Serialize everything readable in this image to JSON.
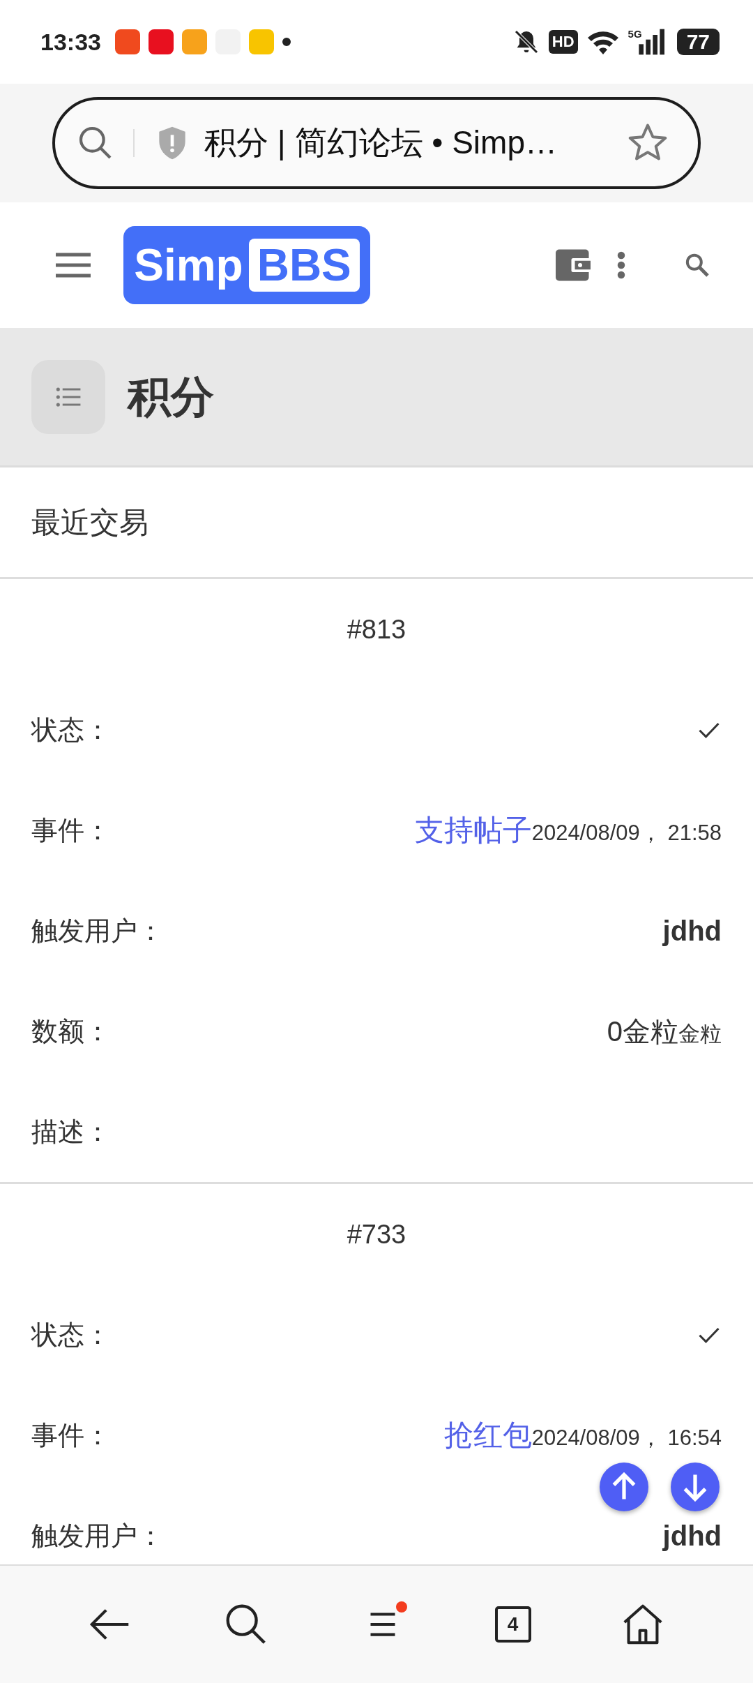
{
  "status_bar": {
    "time": "13:33",
    "notifications": [
      {
        "color": "#f04a1e"
      },
      {
        "color": "#e8101f"
      },
      {
        "color": "#f7a21b"
      },
      {
        "color": "#f2f2f2"
      },
      {
        "color": "#f8c400"
      }
    ],
    "network": "5G",
    "hd": "HD",
    "battery": "77"
  },
  "address_bar": {
    "title": "积分 | 简幻论坛 • Simp…"
  },
  "header": {
    "logo": {
      "text": "Simp",
      "box": "BBS"
    }
  },
  "page_title": "积分",
  "section_title": "最近交易",
  "transactions": [
    {
      "number": "#813",
      "fields": [
        {
          "kind": "status",
          "label": "状态：",
          "checked": true
        },
        {
          "kind": "event",
          "label": "事件：",
          "link": "支持帖子",
          "time": "2024/08/09， 21:58"
        },
        {
          "kind": "user",
          "label": "触发用户：",
          "value": "jdhd"
        },
        {
          "kind": "amount",
          "label": "数额：",
          "value": "0金粒",
          "unit": "金粒"
        },
        {
          "kind": "text",
          "label": "描述："
        }
      ]
    },
    {
      "number": "#733",
      "fields": [
        {
          "kind": "status",
          "label": "状态：",
          "checked": true
        },
        {
          "kind": "event",
          "label": "事件：",
          "link": "抢红包",
          "time": "2024/08/09， 16:54"
        },
        {
          "kind": "user",
          "label": "触发用户：",
          "value": "jdhd"
        }
      ]
    }
  ],
  "bottom_nav": {
    "tabs": "4",
    "menu_badge": true
  }
}
